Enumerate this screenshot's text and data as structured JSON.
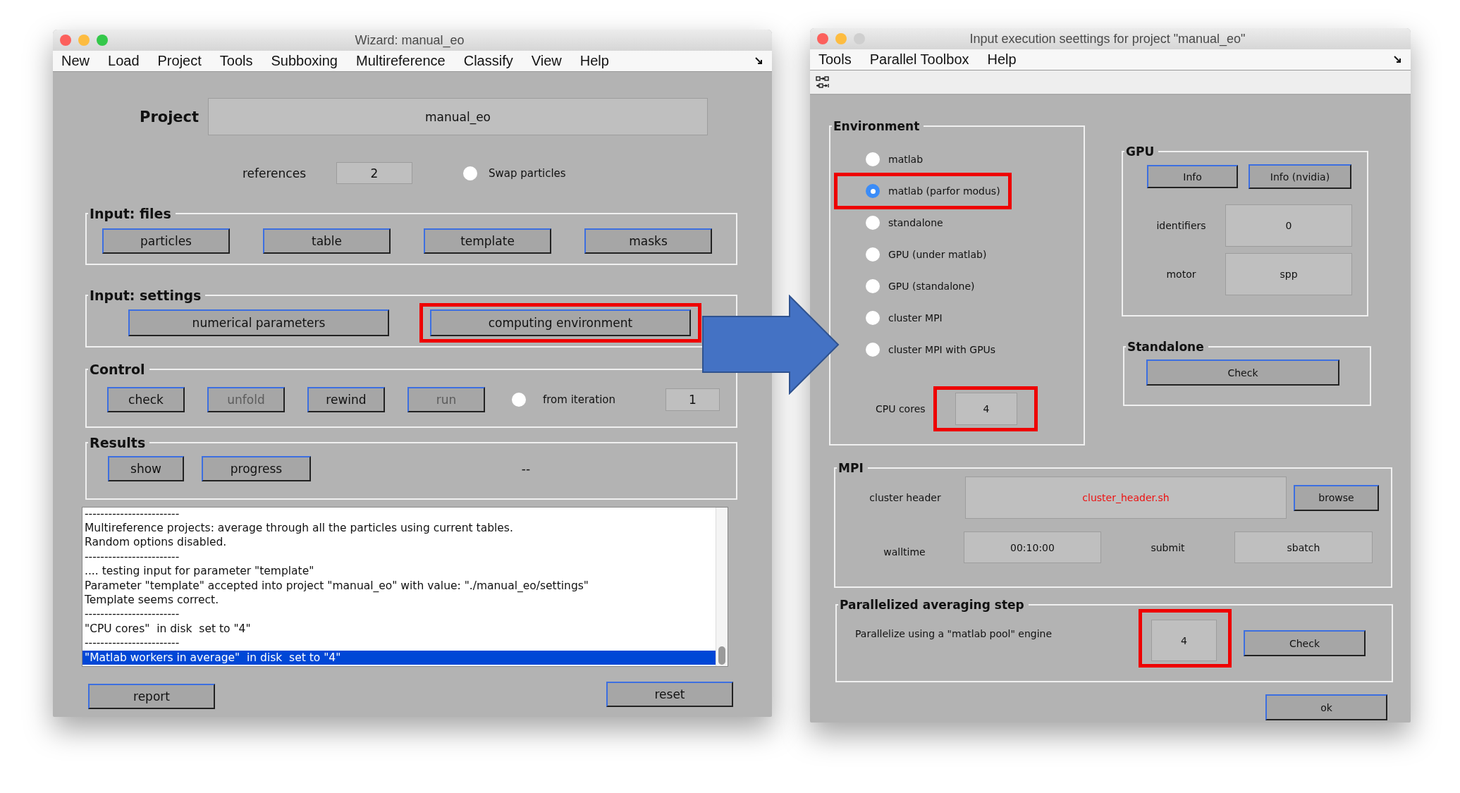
{
  "wizard": {
    "title": "Wizard: manual_eo",
    "menu": [
      "New",
      "Load",
      "Project",
      "Tools",
      "Subboxing",
      "Multireference",
      "Classify",
      "View",
      "Help"
    ],
    "project": {
      "label": "Project",
      "value": "manual_eo"
    },
    "references": {
      "label": "references",
      "value": "2"
    },
    "swap_particles": {
      "label": "Swap particles",
      "checked": false
    },
    "input_files": {
      "title": "Input: files",
      "buttons": [
        "particles",
        "table",
        "template",
        "masks"
      ]
    },
    "input_settings": {
      "title": "Input: settings",
      "buttons": [
        {
          "label": "numerical parameters",
          "highlighted": false
        },
        {
          "label": "computing environment",
          "highlighted": true
        }
      ]
    },
    "control": {
      "title": "Control",
      "buttons": [
        {
          "label": "check",
          "disabled": false
        },
        {
          "label": "unfold",
          "disabled": true
        },
        {
          "label": "rewind",
          "disabled": false
        },
        {
          "label": "run",
          "disabled": true
        }
      ],
      "from_iteration": {
        "label": "from iteration",
        "checked": false,
        "value": "1"
      }
    },
    "results": {
      "title": "Results",
      "buttons": [
        "show",
        "progress"
      ],
      "status": "--"
    },
    "log": [
      {
        "text": "------------------------",
        "selected": false
      },
      {
        "text": "Multireference projects: average through all the particles using current tables.",
        "selected": false
      },
      {
        "text": "Random options disabled.",
        "selected": false
      },
      {
        "text": "------------------------",
        "selected": false
      },
      {
        "text": ".... testing input for parameter \"template\"",
        "selected": false
      },
      {
        "text": "Parameter \"template\" accepted into project \"manual_eo\" with value: \"./manual_eo/settings\"",
        "selected": false
      },
      {
        "text": "Template seems correct.",
        "selected": false
      },
      {
        "text": "------------------------",
        "selected": false
      },
      {
        "text": "\"CPU cores\"  in disk  set to \"4\"",
        "selected": false
      },
      {
        "text": "------------------------",
        "selected": false
      },
      {
        "text": "\"Matlab workers in average\"  in disk  set to \"4\"",
        "selected": true
      }
    ],
    "footer_buttons": [
      "report",
      "reset"
    ]
  },
  "settings": {
    "title": "Input execution seettings for project \"manual_eo\"",
    "menu": [
      "Tools",
      "Parallel Toolbox",
      "Help"
    ],
    "environment": {
      "title": "Environment",
      "options": [
        {
          "label": "matlab",
          "selected": false,
          "highlighted": false
        },
        {
          "label": "matlab (parfor modus)",
          "selected": true,
          "highlighted": true
        },
        {
          "label": "standalone",
          "selected": false,
          "highlighted": false
        },
        {
          "label": "GPU (under matlab)",
          "selected": false,
          "highlighted": false
        },
        {
          "label": "GPU (standalone)",
          "selected": false,
          "highlighted": false
        },
        {
          "label": "cluster MPI",
          "selected": false,
          "highlighted": false
        },
        {
          "label": "cluster MPI with GPUs",
          "selected": false,
          "highlighted": false
        }
      ],
      "cpu_cores": {
        "label": "CPU cores",
        "value": "4",
        "highlighted": true
      }
    },
    "gpu": {
      "title": "GPU",
      "buttons": [
        "Info",
        "Info (nvidia)"
      ],
      "identifiers": {
        "label": "identifiers",
        "value": "0"
      },
      "motor": {
        "label": "motor",
        "value": "spp"
      }
    },
    "standalone": {
      "title": "Standalone",
      "button": "Check"
    },
    "mpi": {
      "title": "MPI",
      "cluster_header": {
        "label": "cluster header",
        "value": "cluster_header.sh"
      },
      "browse": "browse",
      "walltime": {
        "label": "walltime",
        "value": "00:10:00"
      },
      "submit": {
        "label": "submit",
        "value": "sbatch"
      }
    },
    "parallel": {
      "title": "Parallelized averaging step",
      "label": "Parallelize using a \"matlab pool\" engine",
      "value": "4",
      "highlighted": true,
      "button": "Check"
    },
    "ok": "ok"
  }
}
